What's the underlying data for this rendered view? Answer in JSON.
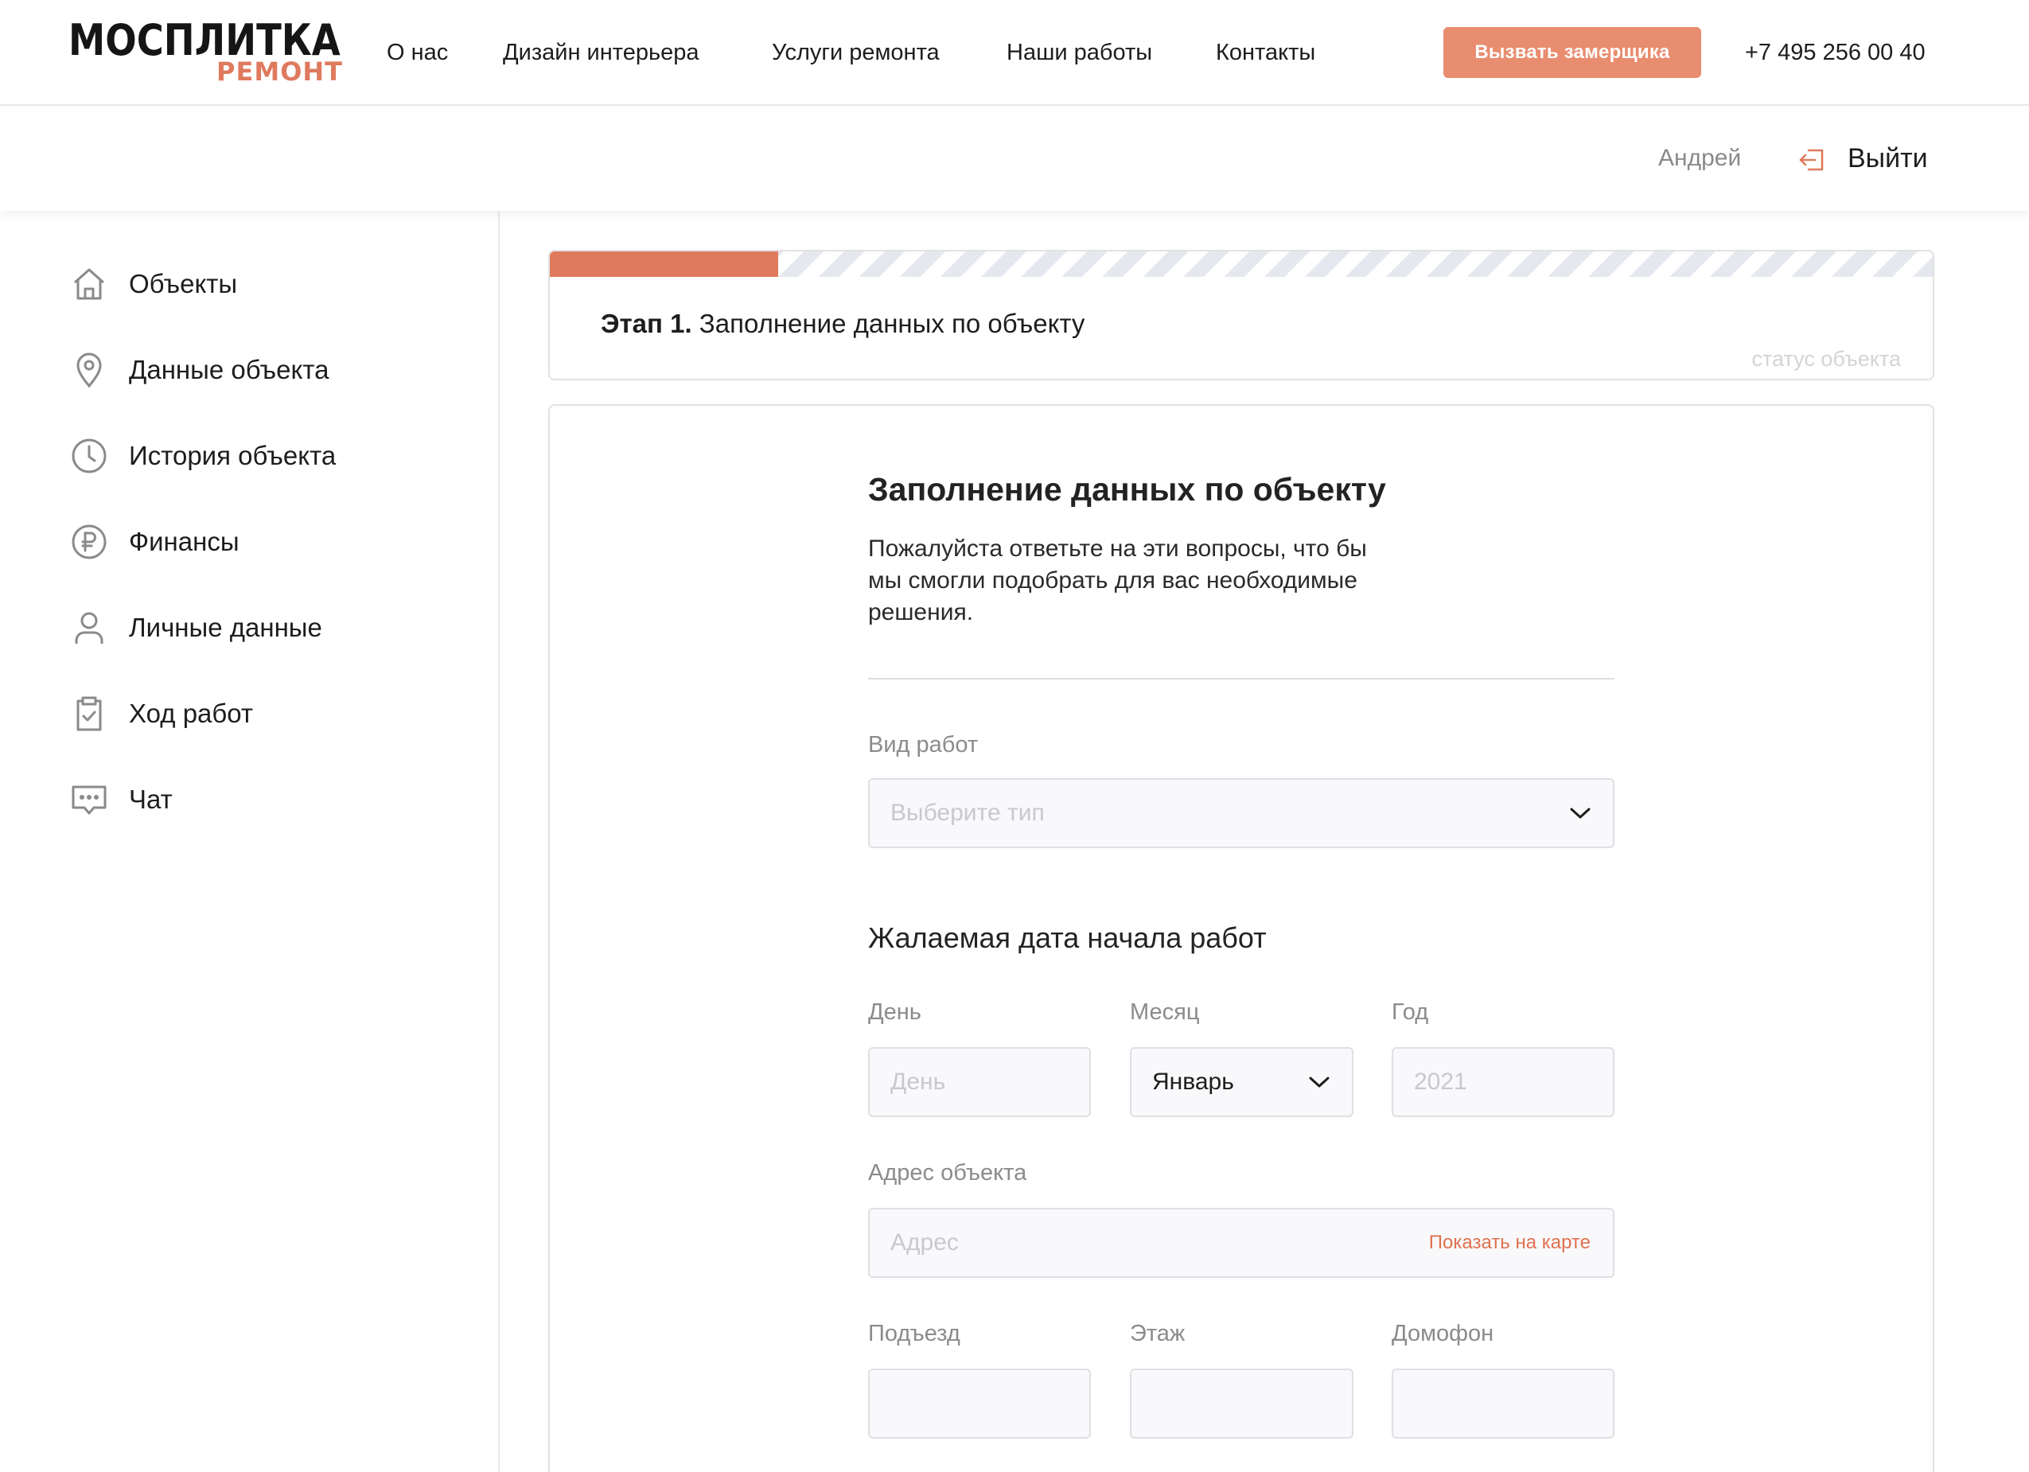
{
  "header": {
    "logo_main": "МОСПЛИТКА",
    "logo_sub": "РЕМОНТ",
    "nav": [
      "О нас",
      "Дизайн интерьера",
      "Услуги ремонта",
      "Наши работы",
      "Контакты"
    ],
    "cta_label": "Вызвать замерщика",
    "phone": "+7 495 256 00 40"
  },
  "userbar": {
    "username": "Андрей",
    "logout_label": "Выйти"
  },
  "sidebar": {
    "items": [
      {
        "label": "Объекты",
        "icon": "home-icon"
      },
      {
        "label": "Данные объекта",
        "icon": "location-pin-icon"
      },
      {
        "label": "История объекта",
        "icon": "clock-icon"
      },
      {
        "label": "Финансы",
        "icon": "ruble-icon"
      },
      {
        "label": "Личные данные",
        "icon": "user-icon"
      },
      {
        "label": "Ход работ",
        "icon": "clipboard-check-icon"
      },
      {
        "label": "Чат",
        "icon": "chat-icon"
      }
    ]
  },
  "stage": {
    "prefix": "Этап 1.",
    "title": "Заполнение данных по объекту",
    "status": "статус объекта",
    "progress_fraction": 0.165
  },
  "form": {
    "title": "Заполнение данных по объекту",
    "description": "Пожалуйста ответьте на эти вопросы, что бы мы смогли подобрать для вас необходимые решения.",
    "work_type": {
      "label": "Вид работ",
      "placeholder": "Выберите тип"
    },
    "start_date": {
      "title": "Жалаемая дата начала работ",
      "day": {
        "label": "День",
        "placeholder": "День"
      },
      "month": {
        "label": "Месяц",
        "value": "Январь"
      },
      "year": {
        "label": "Год",
        "placeholder": "2021"
      }
    },
    "address": {
      "label": "Адрес объекта",
      "placeholder": "Адрес",
      "map_link": "Показать на карте"
    },
    "entrance": {
      "label": "Подъезд"
    },
    "floor": {
      "label": "Этаж"
    },
    "intercom": {
      "label": "Домофон"
    }
  },
  "colors": {
    "accent": "#e07a5c",
    "cta": "#e88d70",
    "link": "#e0714f"
  }
}
